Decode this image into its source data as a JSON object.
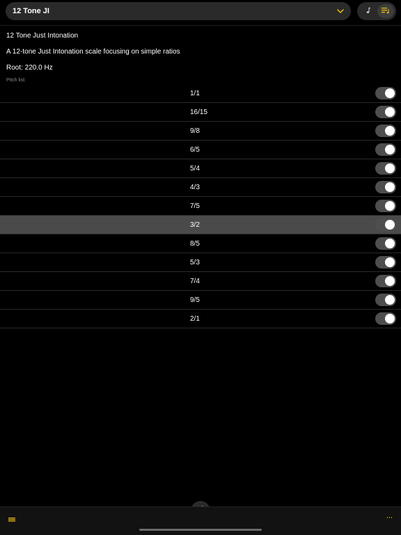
{
  "header": {
    "scale_selector_label": "12 Tone JI",
    "accent_color": "#f3c010"
  },
  "segmented": {
    "items": [
      {
        "icon": "music-note-icon",
        "active": false
      },
      {
        "icon": "scale-list-icon",
        "active": true
      }
    ]
  },
  "scale": {
    "name": "12 Tone Just Intonation",
    "description": "A 12-tone Just Intonation scale focusing on simple ratios",
    "root": "Root: 220.0 Hz",
    "pitch_list_label": "Pitch list:"
  },
  "pitches": [
    {
      "ratio": "1/1",
      "enabled": true
    },
    {
      "ratio": "16/15",
      "enabled": true
    },
    {
      "ratio": "9/8",
      "enabled": true
    },
    {
      "ratio": "6/5",
      "enabled": true
    },
    {
      "ratio": "5/4",
      "enabled": true
    },
    {
      "ratio": "4/3",
      "enabled": true
    },
    {
      "ratio": "7/5",
      "enabled": true
    },
    {
      "ratio": "3/2",
      "enabled": true,
      "selected": true
    },
    {
      "ratio": "8/5",
      "enabled": true
    },
    {
      "ratio": "5/3",
      "enabled": true
    },
    {
      "ratio": "7/4",
      "enabled": true
    },
    {
      "ratio": "9/5",
      "enabled": true
    },
    {
      "ratio": "2/1",
      "enabled": true
    }
  ],
  "bottom_bar": {
    "left_icon": "menu-icon",
    "center_icon": "pencil-icon",
    "right_icon": "more-icon",
    "more_glyph": "···"
  }
}
